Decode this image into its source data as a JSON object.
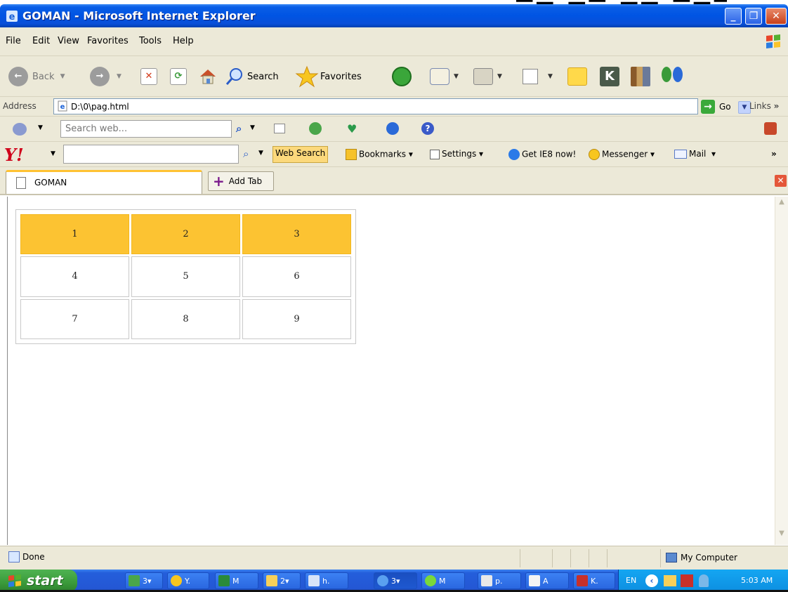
{
  "window": {
    "title": "GOMAN - Microsoft Internet Explorer"
  },
  "menu": [
    "File",
    "Edit",
    "View",
    "Favorites",
    "Tools",
    "Help"
  ],
  "toolbar": {
    "back_label": "Back",
    "search_label": "Search",
    "favorites_label": "Favorites"
  },
  "address": {
    "label": "Address",
    "url": "D:\\0\\pag.html",
    "go_label": "Go",
    "links_label": "Links"
  },
  "searchweb": {
    "placeholder": "Search web..."
  },
  "yahoo": {
    "websearch_label": "Web Search",
    "bookmarks_label": "Bookmarks",
    "settings_label": "Settings",
    "ie8_label": "Get IE8 now!",
    "messenger_label": "Messenger",
    "mail_label": "Mail"
  },
  "tabs": {
    "active_label": "GOMAN",
    "add_tab_label": "Add Tab"
  },
  "grid": [
    [
      "1",
      "2",
      "3"
    ],
    [
      "4",
      "5",
      "6"
    ],
    [
      "7",
      "8",
      "9"
    ]
  ],
  "status": {
    "text": "Done",
    "zone": "My Computer"
  },
  "taskbar": {
    "start_label": "start",
    "tasks": [
      "3",
      "Y.",
      "M",
      "2",
      "h.",
      "3",
      "M",
      "p.",
      "A",
      "K."
    ],
    "language": "EN",
    "clock": "5:03 AM"
  },
  "colors": {
    "highlight_row": "#fcc332",
    "titlebar": "#0054e3",
    "taskbar": "#245edb"
  }
}
